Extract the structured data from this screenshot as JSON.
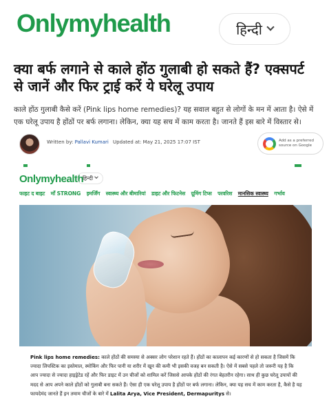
{
  "header": {
    "logo": "Onlymyhealth",
    "language_button": "हिन्दी"
  },
  "article": {
    "headline": "क्या बर्फ लगाने से काले होंठ गुलाबी हो सकते हैं? एक्सपर्ट से जानें और फिर ट्राई करें ये घरेलू उपाय",
    "intro": "काले होंठ गुलाबी कैसे करें (Pink lips home remedies)? यह सवाल बहुत से लोगों के मन में आता है। ऐसे में एक घरेलू उपाय है होंठों पर बर्फ लगाना। लेकिन, क्या यह सच में काम करता है। जानते हैं इस बारे में विस्तार से।",
    "byline_prefix": "Written by:",
    "author": "Pallavi Kumari",
    "updated": "Updated at: May 21, 2025 17:07 IST",
    "google_badge": "Add as a preferred source on Google"
  },
  "embed": {
    "logo": "Onlymyhealth",
    "language_button": "हिन्दी",
    "nav_items": [
      "फाइट द बाइट",
      "माँ STRONG",
      "इमर्जिंग",
      "स्वास्थ्य और बीमारियां",
      "डाइट और फिटनेस",
      "ग्रूमिंग टिप्स",
      "परवरिश",
      "मानसिक स्वास्थ्य",
      "गर्भाव"
    ],
    "caption_lead": "Pink lips home remedies:",
    "caption_body": " काले होंठों की समस्या से अक्सर लोग परेशान रहते हैं। होंठों का कालापन कई कारणों से हो सकता है जिसमें कि ज्यादा लिपस्टिक का इस्तेमाल, स्मोकिंग और फिर पानी या शरीर में खून की कमी भी इसकी वजह बन सकती है। ऐसे में सबसे पहले तो जरूरी यह है कि आप ज्यादा से ज्यादा हाइड्रेटेड रहें और फिर डाइट में उन चीजों को शामिल करें जिससे आपके होंठों की रंगत बेहतरीन रहेगा। साथ ही कुछ घरेलू उपायों की मदद से आप अपने काले होंठों को गुलाबी बना सकते हैं। ऐसा ही एक घरेलू उपाय है होंठों पर बर्फ लगाना। लेकिन, क्या यह सच में काम करता है, कैसे है यह फायदेमंद जानते हैं इन तमाम चीजों के बारे में ",
    "caption_expert": "Lalita Arya, Vice President, Dermapuritys",
    "caption_end": " से।"
  },
  "colors": {
    "brand_green": "#1f9a4a",
    "link_blue": "#1a4fa0"
  },
  "icons": {
    "language_chevron": "chevron-down-icon",
    "google": "google-icon"
  }
}
